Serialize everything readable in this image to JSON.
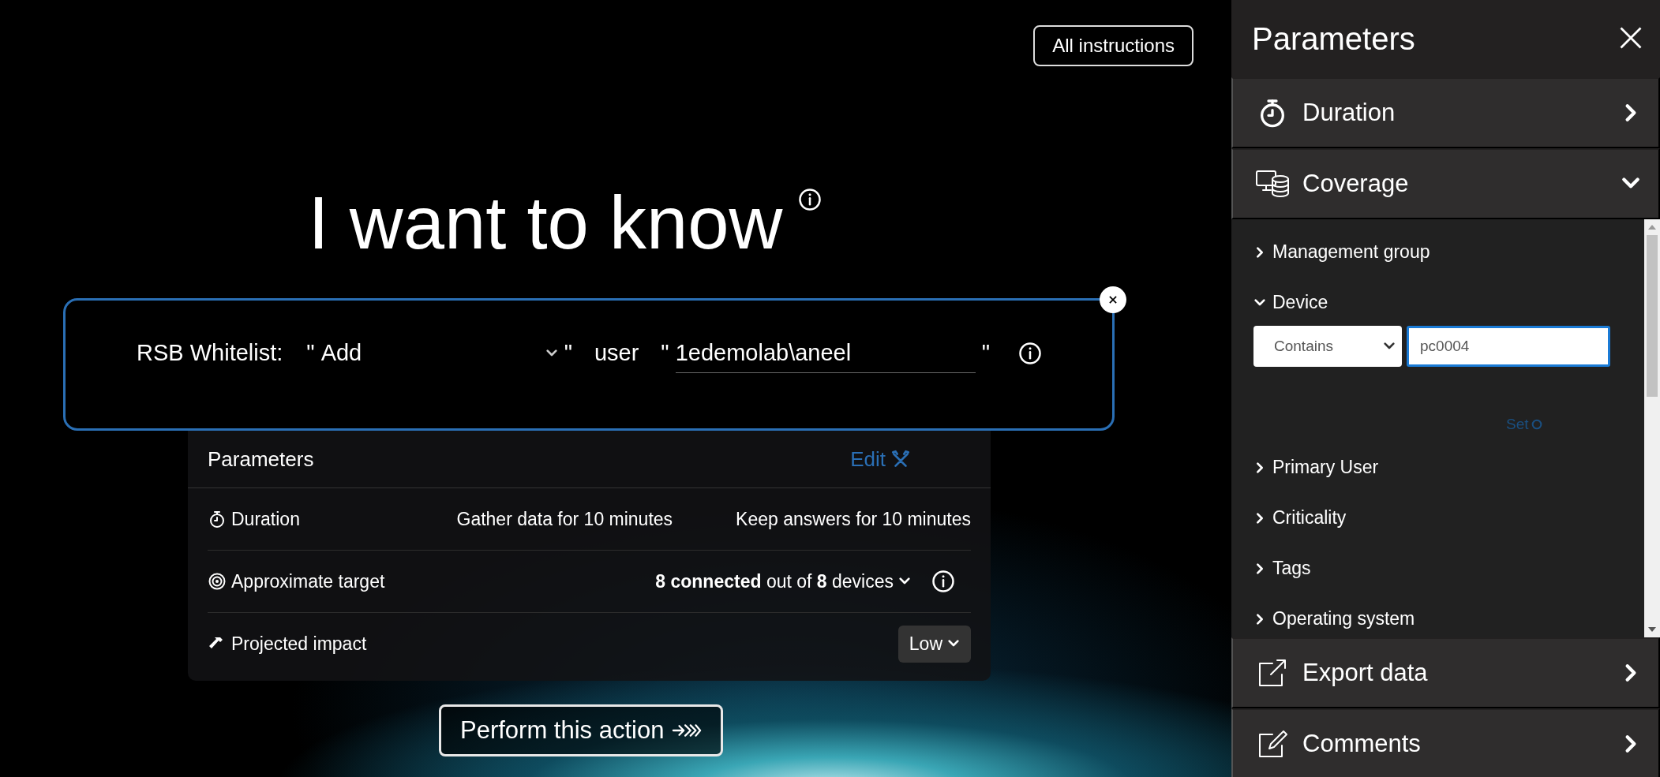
{
  "top_button": "All instructions",
  "heading": "I want to know",
  "query": {
    "parts": [
      {
        "kind": "label",
        "text": "RSB Whitelist:"
      },
      {
        "kind": "quote",
        "text": "\""
      },
      {
        "kind": "select",
        "text": "Add"
      },
      {
        "kind": "quote",
        "text": "\""
      },
      {
        "kind": "word",
        "text": "user"
      },
      {
        "kind": "quote",
        "text": "\""
      },
      {
        "kind": "input",
        "text": "1edemolab\\aneel"
      },
      {
        "kind": "quote",
        "text": "\""
      },
      {
        "kind": "info"
      }
    ]
  },
  "summary": {
    "title": "Parameters",
    "edit": "Edit",
    "rows": [
      {
        "label": "Duration",
        "kind": "pair",
        "values": [
          "Gather data for 10 minutes",
          "Keep answers for 10 minutes"
        ]
      },
      {
        "label": "Approximate target",
        "kind": "dropdown-info",
        "values": [
          "**8 connected** out of **8** devices"
        ]
      },
      {
        "label": "Projected impact",
        "kind": "select",
        "values": [
          "Low"
        ]
      }
    ]
  },
  "perform_button": "Perform this action",
  "panel": {
    "title": "Parameters",
    "sections": [
      {
        "label": "Duration",
        "expanded": false
      },
      {
        "label": "Coverage",
        "expanded": true,
        "filters": [
          {
            "label": "Management group",
            "expanded": false
          },
          {
            "label": "Device",
            "expanded": true,
            "operator": "Contains",
            "value": "pc0004",
            "set": "Set"
          },
          {
            "label": "Primary User",
            "expanded": false
          },
          {
            "label": "Criticality",
            "expanded": false
          },
          {
            "label": "Tags",
            "expanded": false
          },
          {
            "label": "Operating system",
            "expanded": false
          }
        ]
      },
      {
        "label": "Export data",
        "expanded": false
      },
      {
        "label": "Comments",
        "expanded": false
      }
    ]
  }
}
